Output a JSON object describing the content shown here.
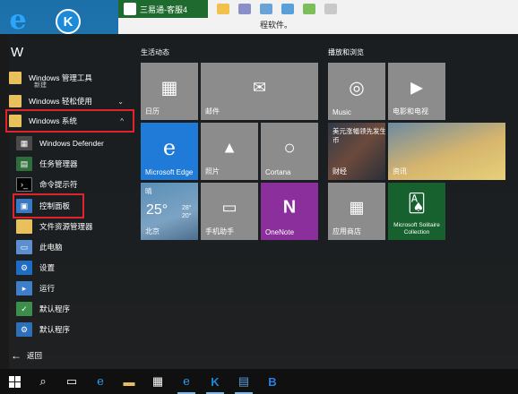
{
  "background_window": {
    "title": "三易通-客服4",
    "content_text": "程软件。"
  },
  "start_menu": {
    "section_letter": "W",
    "apps": [
      {
        "label": "Windows 管理工具",
        "sub": "新建",
        "icon": "folder-icon"
      },
      {
        "label": "Windows 轻松使用",
        "icon": "folder-icon"
      },
      {
        "label": "Windows 系统",
        "icon": "folder-icon",
        "expanded": true
      }
    ],
    "system_items": [
      {
        "label": "Windows Defender",
        "icon": "shield-icon"
      },
      {
        "label": "任务管理器",
        "icon": "task-manager-icon"
      },
      {
        "label": "命令提示符",
        "icon": "command-prompt-icon"
      },
      {
        "label": "控制面板",
        "icon": "control-panel-icon"
      },
      {
        "label": "文件资源管理器",
        "icon": "folder-explorer-icon"
      },
      {
        "label": "此电脑",
        "icon": "computer-icon"
      },
      {
        "label": "设置",
        "icon": "gear-icon"
      },
      {
        "label": "运行",
        "icon": "run-icon"
      },
      {
        "label": "默认程序",
        "icon": "default-programs-icon"
      },
      {
        "label": "默认程序",
        "icon": "default-programs-icon"
      }
    ],
    "back_label": "返回",
    "highlighted": [
      "Windows 系统",
      "控制面板"
    ]
  },
  "tile_groups": [
    {
      "title": "生活动态",
      "tiles": [
        {
          "label": "日历",
          "icon": "calendar-icon",
          "color": "#8c8c8c"
        },
        {
          "label": "邮件",
          "icon": "mail-icon",
          "color": "#8c8c8c"
        },
        {
          "label": "Microsoft Edge",
          "icon": "edge-icon",
          "color": "#1f7ad8"
        },
        {
          "label": "照片",
          "icon": "photos-icon",
          "color": "#8c8c8c"
        },
        {
          "label": "Cortana",
          "icon": "cortana-icon",
          "color": "#8c8c8c"
        },
        {
          "label": "手机助手",
          "icon": "phone-companion-icon",
          "color": "#8c8c8c"
        },
        {
          "label": "OneNote",
          "icon": "onenote-icon",
          "color": "#8a2f9c"
        }
      ],
      "weather": {
        "condition": "晴",
        "temp": "25°",
        "high": "28°",
        "low": "20°",
        "city": "北京"
      }
    },
    {
      "title": "播放和浏览",
      "tiles": [
        {
          "label": "Music",
          "icon": "music-icon",
          "color": "#8c8c8c"
        },
        {
          "label": "电影和电视",
          "icon": "film-icon",
          "color": "#8c8c8c"
        },
        {
          "label": "财经",
          "icon": "finance-icon"
        },
        {
          "label": "资讯",
          "icon": "news-icon"
        },
        {
          "label": "应用商店",
          "icon": "store-icon",
          "color": "#8c8c8c"
        },
        {
          "label": "Microsoft Solitaire Collection",
          "icon": "cards-icon"
        }
      ],
      "news_caption": "美元涨幅领先发生币"
    }
  ],
  "taskbar": {
    "items": [
      "start",
      "search",
      "task-view",
      "edge",
      "file-explorer",
      "store",
      "ie",
      "k-app",
      "app-blue",
      "app-b"
    ]
  }
}
